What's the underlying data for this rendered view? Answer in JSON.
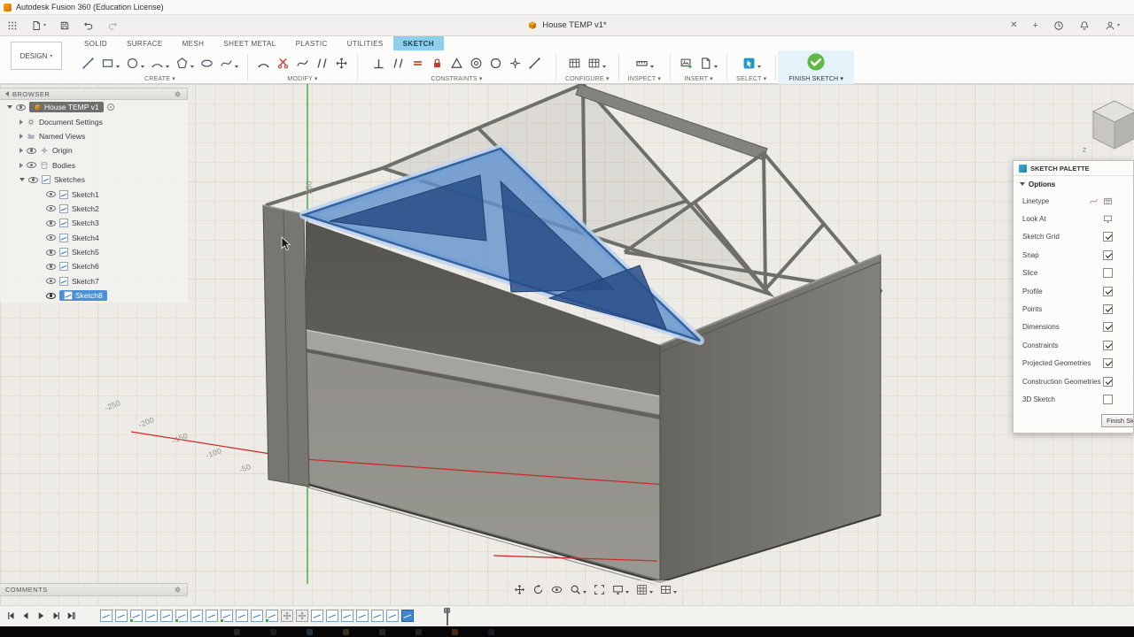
{
  "window": {
    "title": "Autodesk Fusion 360 (Education License)"
  },
  "app_bar": {
    "document_tab": "House TEMP v1*",
    "close_tab_glyph": "✕",
    "add_tab_glyph": "+"
  },
  "ribbon": {
    "design_label": "DESIGN",
    "tabs": [
      {
        "label": "SOLID",
        "active": false
      },
      {
        "label": "SURFACE",
        "active": false
      },
      {
        "label": "MESH",
        "active": false
      },
      {
        "label": "SHEET METAL",
        "active": false
      },
      {
        "label": "PLASTIC",
        "active": false
      },
      {
        "label": "UTILITIES",
        "active": false
      },
      {
        "label": "SKETCH",
        "active": true
      }
    ],
    "groups": {
      "create": "CREATE ▾",
      "modify": "MODIFY ▾",
      "constraints": "CONSTRAINTS ▾",
      "configure": "CONFIGURE ▾",
      "inspect": "INSPECT ▾",
      "insert": "INSERT ▾",
      "select": "SELECT ▾",
      "finish": "FINISH SKETCH ▾"
    }
  },
  "browser": {
    "title": "BROWSER",
    "root_label": "House TEMP v1",
    "items": [
      {
        "label": "Document Settings"
      },
      {
        "label": "Named Views"
      },
      {
        "label": "Origin"
      },
      {
        "label": "Bodies"
      },
      {
        "label": "Sketches"
      }
    ],
    "sketches": [
      {
        "label": "Sketch1"
      },
      {
        "label": "Sketch2"
      },
      {
        "label": "Sketch3"
      },
      {
        "label": "Sketch4"
      },
      {
        "label": "Sketch5"
      },
      {
        "label": "Sketch6"
      },
      {
        "label": "Sketch7"
      },
      {
        "label": "Sketch8",
        "active": true
      }
    ]
  },
  "sketch_palette": {
    "title": "SKETCH PALETTE",
    "options_label": "Options",
    "rows": [
      {
        "label": "Linetype",
        "control": "linetype"
      },
      {
        "label": "Look At",
        "control": "lookat"
      },
      {
        "label": "Sketch Grid",
        "control": "checkbox",
        "checked": true
      },
      {
        "label": "Snap",
        "control": "checkbox",
        "checked": true
      },
      {
        "label": "Slice",
        "control": "checkbox",
        "checked": false
      },
      {
        "label": "Profile",
        "control": "checkbox",
        "checked": true
      },
      {
        "label": "Points",
        "control": "checkbox",
        "checked": true
      },
      {
        "label": "Dimensions",
        "control": "checkbox",
        "checked": true
      },
      {
        "label": "Constraints",
        "control": "checkbox",
        "checked": true
      },
      {
        "label": "Projected Geometries",
        "control": "checkbox",
        "checked": true
      },
      {
        "label": "Construction Geometries",
        "control": "checkbox",
        "checked": true
      },
      {
        "label": "3D Sketch",
        "control": "checkbox",
        "checked": false
      }
    ],
    "finish_button": "Finish Sketch"
  },
  "canvas": {
    "dimension_labels": [
      "-250",
      "-200",
      "-150",
      "-100",
      "-50"
    ],
    "vertical_axis_label": "250"
  },
  "viewcube": {
    "axis_z": "Z"
  },
  "view_navbar": {
    "icons": [
      {
        "name": "pan"
      },
      {
        "name": "orbit"
      },
      {
        "name": "look-at"
      },
      {
        "name": "zoom",
        "caret": true
      },
      {
        "name": "fit-view"
      },
      {
        "name": "display-settings",
        "caret": true
      },
      {
        "name": "grid-settings",
        "caret": true
      },
      {
        "name": "viewports",
        "caret": true
      }
    ]
  },
  "comments": {
    "title": "COMMENTS"
  },
  "timeline": {
    "playback": [
      {
        "name": "skip-start"
      },
      {
        "name": "step-back"
      },
      {
        "name": "play"
      },
      {
        "name": "step-forward"
      },
      {
        "name": "skip-end"
      }
    ],
    "items": [
      {
        "type": "sketch"
      },
      {
        "type": "sketch"
      },
      {
        "type": "sketch",
        "badge": true
      },
      {
        "type": "sketch"
      },
      {
        "type": "sketch"
      },
      {
        "type": "sketch",
        "badge": true
      },
      {
        "type": "sketch"
      },
      {
        "type": "sketch"
      },
      {
        "type": "sketch",
        "badge": true
      },
      {
        "type": "sketch"
      },
      {
        "type": "sketch"
      },
      {
        "type": "sketch",
        "badge": true
      },
      {
        "type": "move"
      },
      {
        "type": "move"
      },
      {
        "type": "sketch"
      },
      {
        "type": "sketch"
      },
      {
        "type": "sketch"
      },
      {
        "type": "sketch"
      },
      {
        "type": "sketch"
      },
      {
        "type": "sketch"
      },
      {
        "type": "sketch",
        "active": true
      }
    ]
  },
  "colors": {
    "accent_blue": "#3a86d0",
    "selection_blue": "#5a8cc8",
    "finish_green": "#62b746",
    "axis_red": "#cc2a2a",
    "axis_green": "#3aa53a",
    "tab_active_bg": "#8ed0ec"
  }
}
